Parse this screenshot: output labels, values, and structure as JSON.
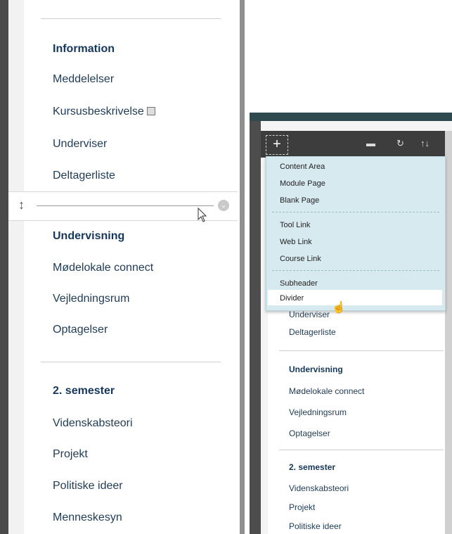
{
  "left_menu": {
    "sections": [
      {
        "heading": "Information",
        "items": [
          "Meddelelser",
          "Kursusbeskrivelse",
          "Underviser",
          "Deltagerliste"
        ]
      },
      {
        "heading": "Undervisning",
        "items": [
          "Mødelokale connect",
          "Vejledningsrum",
          "Optagelser"
        ]
      },
      {
        "heading": "2. semester",
        "items": [
          "Videnskabsteori",
          "Projekt",
          "Politiske ideer",
          "Menneskesyn"
        ]
      }
    ]
  },
  "icons": {
    "external": "external-link-icon",
    "drag": "drag-handle-icon",
    "options": "chevron-circle-icon",
    "plus": "plus-icon",
    "folder": "folder-icon",
    "refresh": "refresh-icon",
    "sort": "sort-icon"
  },
  "toolbar": {
    "plus": "+",
    "refresh": "↻",
    "sort": "↑↓",
    "folder": "▬"
  },
  "dropdown": {
    "items": [
      "Content Area",
      "Module Page",
      "Blank Page",
      "Tool Link",
      "Web Link",
      "Course Link",
      "Subheader",
      "Divider"
    ],
    "hovered": "Divider"
  },
  "right_menu": {
    "partial_item": "Underviser",
    "items1": [
      "Deltagerliste"
    ],
    "heading2": "Undervisning",
    "items2": [
      "Mødelokale connect",
      "Vejledningsrum",
      "Optagelser"
    ],
    "heading3": "2. semester",
    "items3": [
      "Videnskabsteori",
      "Projekt",
      "Politiske ideer"
    ]
  }
}
